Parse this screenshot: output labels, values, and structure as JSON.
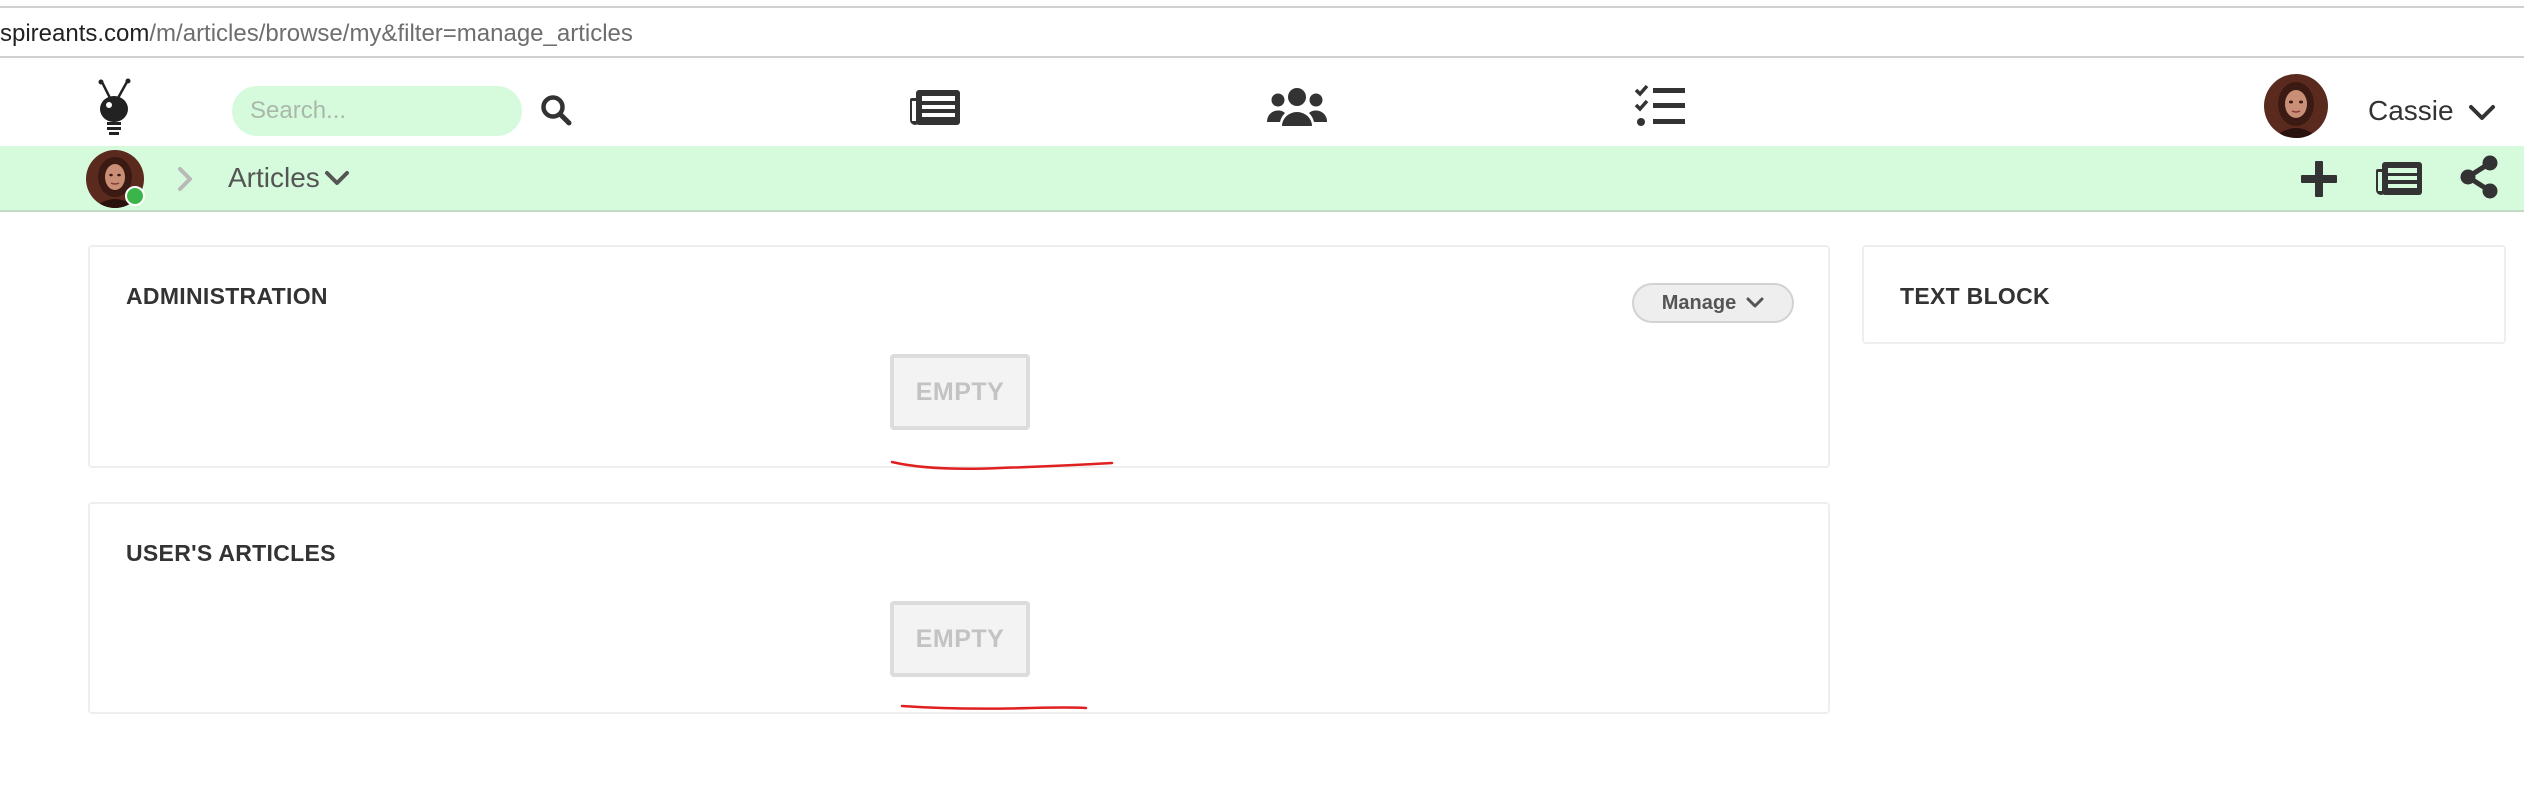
{
  "browser": {
    "url_host": "spireants.com",
    "url_path": "/m/articles/browse/my&filter=manage_articles"
  },
  "top_nav": {
    "logo_icon": "ant-bulb-logo-icon",
    "search": {
      "placeholder": "Search...",
      "value": ""
    },
    "icons": [
      "search-icon",
      "articles-icon",
      "people-icon",
      "tasks-icon"
    ],
    "user": {
      "name": "Cassie",
      "avatar": "avatar"
    }
  },
  "breadcrumb": {
    "title": "Articles",
    "actions": [
      "add-icon",
      "articles-icon",
      "share-icon"
    ],
    "online_color": "#3bb54a"
  },
  "panels": {
    "administration": {
      "title": "ADMINISTRATION",
      "manage_label": "Manage",
      "empty_label": "EMPTY"
    },
    "users_articles": {
      "title": "USER'S ARTICLES",
      "empty_label": "EMPTY"
    },
    "text_block": {
      "title": "TEXT BLOCK"
    }
  },
  "colors": {
    "accent_green": "#d6fbdc",
    "icon_dark": "#333333",
    "annotation_red": "#e02020"
  }
}
